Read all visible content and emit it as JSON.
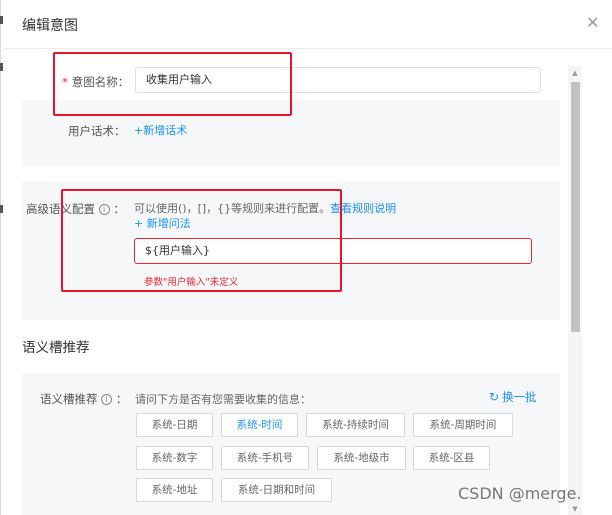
{
  "dialog": {
    "title": "编辑意图",
    "close_icon": "close-icon"
  },
  "intent_name": {
    "required_mark": "*",
    "label": "意图名称：",
    "value": "收集用户输入"
  },
  "user_utterance": {
    "label": "用户话术：",
    "add_link": "+新增话术"
  },
  "advanced_config": {
    "label": "高级语义配置",
    "info_icon": "ⓘ",
    "colon": "：",
    "hint": "可以使用()，[]，{}等规则来进行配置。",
    "rules_link": "查看规则说明",
    "add_syntax_link": "+ 新增问法",
    "syntax_value": "${用户输入}",
    "error_message": "参数\"用户输入\"未定义"
  },
  "slot_section": {
    "title": "语义槽推荐",
    "label": "语义槽推荐",
    "info_icon": "ⓘ",
    "colon": "：",
    "prompt": "请问下方是否有您需要收集的信息：",
    "refresh_label": "换一批",
    "chips": [
      {
        "label": "系统-日期"
      },
      {
        "label": "系统-时间"
      },
      {
        "label": "系统-持续时间"
      },
      {
        "label": "系统-周期时间"
      },
      {
        "label": "系统-数字"
      },
      {
        "label": "系统-手机号"
      },
      {
        "label": "系统-地级市"
      },
      {
        "label": "系统-区县"
      },
      {
        "label": "系统-地址"
      },
      {
        "label": "系统-日期和时间"
      }
    ],
    "active_chip_index": 1
  },
  "watermark": "CSDN @merge.",
  "colors": {
    "link": "#1890ff",
    "error": "#f5222d",
    "annotation_red": "#e6152d"
  }
}
